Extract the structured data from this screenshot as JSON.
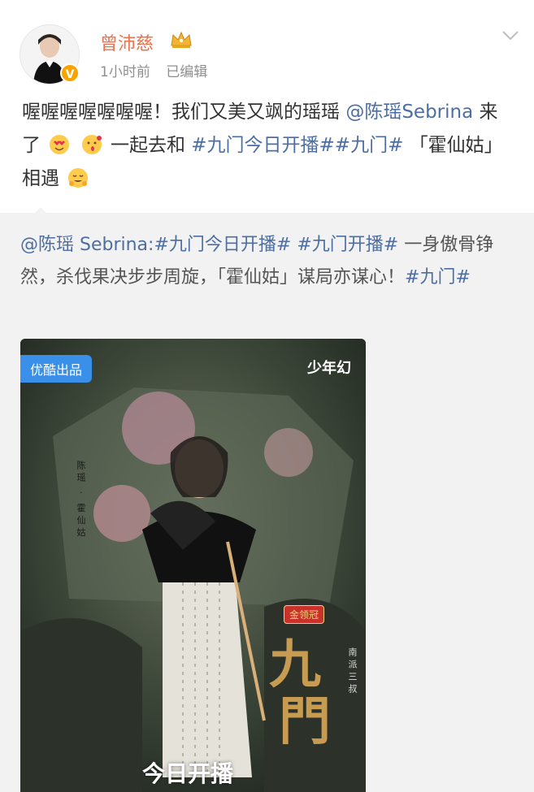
{
  "user": {
    "name": "曾沛慈",
    "verified_badge": "V",
    "time": "1小时前",
    "edited": "已编辑"
  },
  "post": {
    "text_prefix": "喔喔喔喔喔喔喔！我们又美又飒的瑶瑶 ",
    "mention": "@陈瑶Sebrina",
    "text_mid": " 来了",
    "text_after_emoji": " 一起去和 ",
    "tag1": "#九门今日开播#",
    "tag2": "#九门#",
    "text_end": "「霍仙姑」相遇"
  },
  "repost": {
    "mention": "@陈瑶 Sebrina:",
    "tag1": "#九门今日开播#",
    "tag2": "#九门开播#",
    "text": " 一身傲骨铮然，杀伐果决步步周旋，「霍仙姑」谋局亦谋心！",
    "tag3": "#九门#"
  },
  "poster": {
    "badge": "优酷出品",
    "brand": "少年幻",
    "gold_logo": "金领冠",
    "actor_label": "陈瑶 · 霍仙姑",
    "title_chars": [
      "九",
      "門"
    ],
    "side_note": "南派三叔",
    "premiere": "今日开播"
  },
  "colors": {
    "username": "#eb7350",
    "link": "#4c6ea3",
    "repost_bg": "#f2f2f2",
    "badge_blue": "#3a8fe8"
  }
}
